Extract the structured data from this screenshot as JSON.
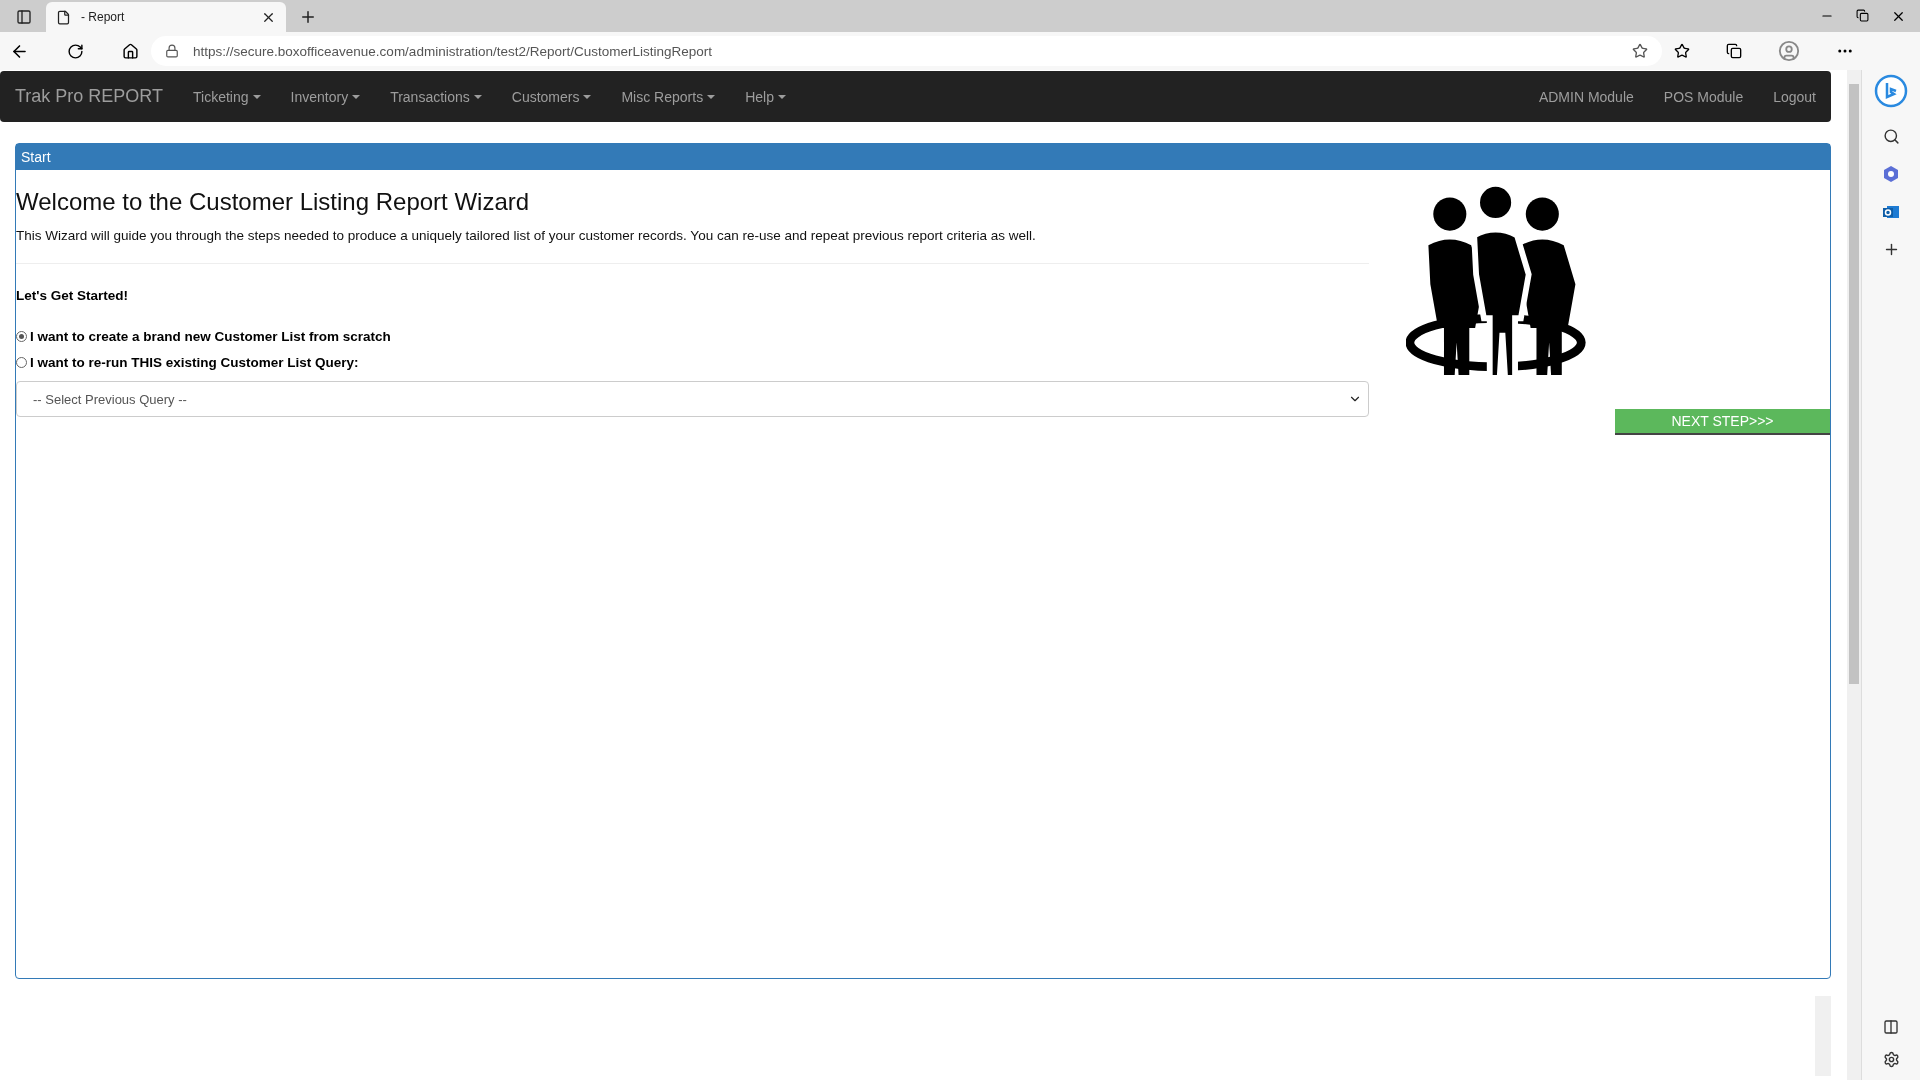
{
  "browser": {
    "tab_title": "- Report",
    "url": "https://secure.boxofficeavenue.com/administration/test2/Report/CustomerListingReport"
  },
  "navbar": {
    "brand": "Trak Pro REPORT",
    "menus": [
      {
        "label": "Ticketing"
      },
      {
        "label": "Inventory"
      },
      {
        "label": "Transactions"
      },
      {
        "label": "Customers"
      },
      {
        "label": "Misc Reports"
      },
      {
        "label": "Help"
      }
    ],
    "right_links": [
      "ADMIN Module",
      "POS Module",
      "Logout"
    ]
  },
  "panel": {
    "heading": "Start",
    "title": "Welcome to the Customer Listing Report Wizard",
    "intro": "This Wizard will guide you through the steps needed to produce a uniquely tailored list of your customer records. You can re-use and repeat previous report criteria as well.",
    "prompt": "Let's Get Started!",
    "options": [
      {
        "label": "I want to create a brand new Customer List from scratch",
        "selected": true
      },
      {
        "label": "I want to re-run THIS existing Customer List Query:",
        "selected": false
      }
    ],
    "query_select": "-- Select Previous Query --",
    "next_button": "NEXT STEP>>>"
  }
}
